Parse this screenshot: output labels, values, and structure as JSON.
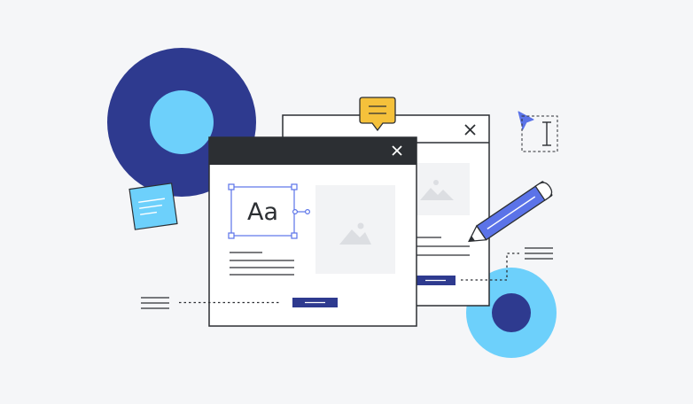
{
  "front_window": {
    "typography_sample": "Aa"
  },
  "icons": {
    "close_front": "close-icon",
    "close_back": "close-icon",
    "comment": "speech-bubble-icon",
    "cursor": "pointer-cursor-icon",
    "text_cursor": "text-cursor-icon",
    "pencil": "pencil-icon",
    "image": "image-placeholder-icon",
    "sticky_note": "sticky-note-icon"
  },
  "colors": {
    "background": "#f5f6f8",
    "navy": "#2e3a8f",
    "light_blue": "#6dd0fb",
    "accent_blue": "#5b73e8",
    "window_header": "#2c2f33",
    "speech_bubble": "#f5c13b",
    "outline": "#2c2f33"
  }
}
